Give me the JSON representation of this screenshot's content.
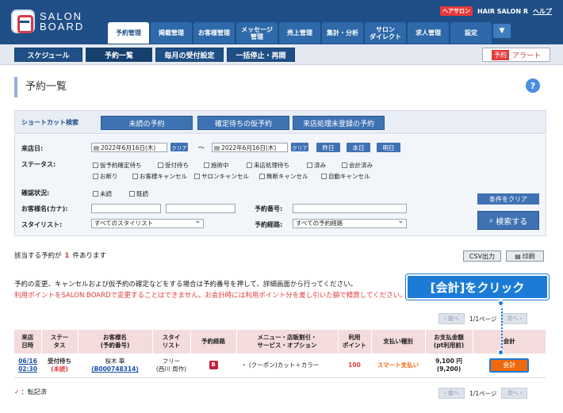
{
  "app": {
    "logo_line1": "SALON",
    "logo_line2": "BOARD",
    "salon_badge": "ヘアサロン",
    "salon_name": "HAIR SALON R",
    "help": "ヘルプ"
  },
  "tabs": [
    "予約管理",
    "掲載管理",
    "お客様管理",
    "メッセージ\n管理",
    "売上管理",
    "集計・分析",
    "サロン\nダイレクト",
    "求人管理",
    "設定"
  ],
  "subnav": {
    "items": [
      "スケジュール",
      "予約一覧",
      "毎月の受付設定",
      "一括停止・再開"
    ],
    "alert_tag": "予約",
    "alert_label": "アラート"
  },
  "page_title": "予約一覧",
  "shortcut": {
    "label": "ショートカット検索",
    "buttons": [
      "未読の予約",
      "確定待ちの仮予約",
      "来店処理未登録の予約"
    ]
  },
  "search": {
    "visit_date_label": "来店日:",
    "date_from": "2022年6月16日(木)",
    "date_to": "2022年6月16日(木)",
    "clear_small": "クリア",
    "tilde": "～",
    "day_buttons": [
      "昨日",
      "本日",
      "明日"
    ],
    "status_label": "ステータス:",
    "status_row1": [
      "仮予約確定待ち",
      "受付待ち",
      "施術中",
      "来店処理待ち",
      "済み",
      "会計済み"
    ],
    "status_row2": [
      "お断り",
      "お客様キャンセル",
      "サロンキャンセル",
      "無断キャンセル",
      "自動キャンセル"
    ],
    "confirm_label": "確認状況:",
    "confirm_options": [
      "未読",
      "既読"
    ],
    "customer_label": "お客様名(カナ):",
    "reservation_no_label": "予約番号:",
    "stylist_label": "スタイリスト:",
    "stylist_value": "すべてのスタイリスト",
    "route_label": "予約経路:",
    "route_value": "すべての予約経路",
    "clear_button": "条件をクリア",
    "search_button": "検索する"
  },
  "result": {
    "prefix": "該当する予約が",
    "count": "1",
    "suffix": "件あります",
    "csv": "CSV出力",
    "print": "印刷"
  },
  "info": {
    "line1": "予約の変更、キャンセルおよび仮予約の確定などをする場合は予約番号を押して、詳細画面から行ってください。",
    "line2": "利用ポイントをSALON BOARDで変更することはできません。お会計時には利用ポイント分を差し引いた額で精算してください。"
  },
  "callout": "[会計]をクリック",
  "pager": {
    "prev": "前へ",
    "next": "次へ",
    "page": "1/1ページ"
  },
  "table": {
    "headers": [
      "来店\n日時",
      "ステー\nタス",
      "お客様名\n(予約番号)",
      "スタイ\nリスト",
      "予約経路",
      "メニュー・店販割引・\nサービス・オプション",
      "利用\nポイント",
      "支払い種別",
      "お支払金額\n(pt利用前)",
      "会計"
    ],
    "row": {
      "date": "06/16",
      "time": "02:30",
      "status1": "受付待ち",
      "status2": "(未読)",
      "name": "桜木 華",
      "res_no": "(B000748314)",
      "stylist1": "フリー",
      "stylist2": "(西川 周作)",
      "route_icon": "B",
      "menu": "・ (クーポン)カット＋カラー",
      "points": "100",
      "pay_type": "スマート支払い",
      "amount": "9,100 円",
      "amount_pre": "(9,200)",
      "pay_btn": "会計"
    }
  },
  "legend": "：転記済"
}
